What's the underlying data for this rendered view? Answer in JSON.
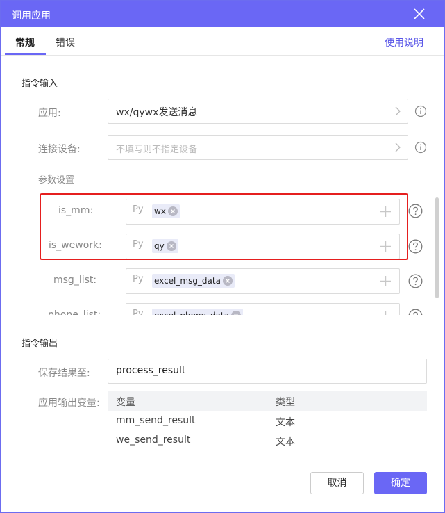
{
  "dialog": {
    "title": "调用应用",
    "tabs": [
      {
        "label": "常规",
        "active": true
      },
      {
        "label": "错误",
        "active": false
      }
    ],
    "help_link": "使用说明"
  },
  "input_section": {
    "title": "指令输入",
    "app_label": "应用:",
    "app_value": "wx/qywx发送消息",
    "device_label": "连接设备:",
    "device_placeholder": "不填写则不指定设备",
    "params_title": "参数设置",
    "params": [
      {
        "label": "is_mm:",
        "prefix": "Py",
        "chip": "wx"
      },
      {
        "label": "is_wework:",
        "prefix": "Py",
        "chip": "qy"
      },
      {
        "label": "msg_list:",
        "prefix": "Py",
        "chip": "excel_msg_data"
      },
      {
        "label": "phone_list:",
        "prefix": "Py",
        "chip": "excel_phone_data"
      }
    ]
  },
  "output_section": {
    "title": "指令输出",
    "save_label": "保存结果至:",
    "save_value": "process_result",
    "vars_label": "应用输出变量:",
    "table": {
      "headers": [
        "变量",
        "类型"
      ],
      "rows": [
        [
          "mm_send_result",
          "文本"
        ],
        [
          "we_send_result",
          "文本"
        ]
      ]
    }
  },
  "footer": {
    "cancel_label": "取消",
    "ok_label": "确定"
  },
  "colors": {
    "accent": "#6a67f5",
    "highlight": "#e51f1f"
  }
}
